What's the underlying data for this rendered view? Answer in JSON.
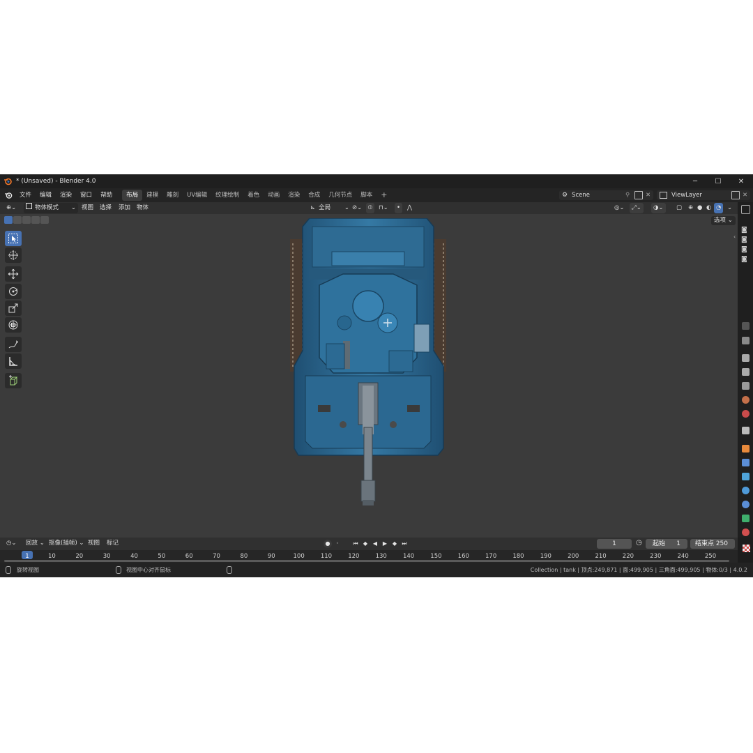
{
  "window": {
    "title": "* (Unsaved) - Blender 4.0",
    "controls": [
      "─",
      "☐",
      "✕"
    ]
  },
  "menu": [
    "文件",
    "编辑",
    "渲染",
    "窗口",
    "帮助"
  ],
  "workspaces": [
    {
      "label": "布局",
      "active": true
    },
    {
      "label": "建模",
      "active": false
    },
    {
      "label": "雕刻",
      "active": false
    },
    {
      "label": "UV编辑",
      "active": false
    },
    {
      "label": "纹理绘制",
      "active": false
    },
    {
      "label": "着色",
      "active": false
    },
    {
      "label": "动画",
      "active": false
    },
    {
      "label": "渲染",
      "active": false
    },
    {
      "label": "合成",
      "active": false
    },
    {
      "label": "几何节点",
      "active": false
    },
    {
      "label": "脚本",
      "active": false
    }
  ],
  "add_workspace": "+",
  "scene": {
    "value": "Scene"
  },
  "view_layer": {
    "value": "ViewLayer"
  },
  "viewport_header": {
    "mode": "物体模式",
    "menus": [
      "视图",
      "选择",
      "添加",
      "物体"
    ],
    "transform_orientation": "全局",
    "options_label": "选项"
  },
  "tools": [
    {
      "name": "select-box-tool",
      "icon": "select-icon",
      "active": true
    },
    {
      "name": "cursor-tool",
      "icon": "cursor-icon",
      "active": false
    },
    {
      "name": "move-tool",
      "icon": "move-icon",
      "active": false
    },
    {
      "name": "rotate-tool",
      "icon": "rotate-icon",
      "active": false
    },
    {
      "name": "scale-tool",
      "icon": "scale-icon",
      "active": false
    },
    {
      "name": "transform-tool",
      "icon": "transform-icon",
      "active": false
    },
    {
      "name": "annotate-tool",
      "icon": "annotate-icon",
      "active": false
    },
    {
      "name": "measure-tool",
      "icon": "measure-icon",
      "active": false
    },
    {
      "name": "add-cube-tool",
      "icon": "add-cube-icon",
      "active": false
    }
  ],
  "timeline": {
    "menus": [
      "回放",
      "抠像(插帧)",
      "视图",
      "标记"
    ],
    "current_frame": "1",
    "start_label": "起始",
    "start_value": "1",
    "end_label": "结束点",
    "end_value": "250",
    "ticks": [
      "1",
      "10",
      "20",
      "30",
      "40",
      "50",
      "60",
      "70",
      "80",
      "90",
      "100",
      "110",
      "120",
      "130",
      "140",
      "150",
      "160",
      "170",
      "180",
      "190",
      "200",
      "210",
      "220",
      "230",
      "240",
      "250"
    ]
  },
  "status": {
    "left_hint": "旋转视图",
    "mid_hint": "视图中心对齐鼠标",
    "stats": "Collection | tank | 顶点:249,871 | 面:499,905 | 三角面:499,905 | 物体:0/3 | 4.0.2"
  },
  "colors": {
    "accent": "#4772b3",
    "viewport_bg": "#3b3b3b",
    "tank_blue": "#2f6f9a"
  }
}
